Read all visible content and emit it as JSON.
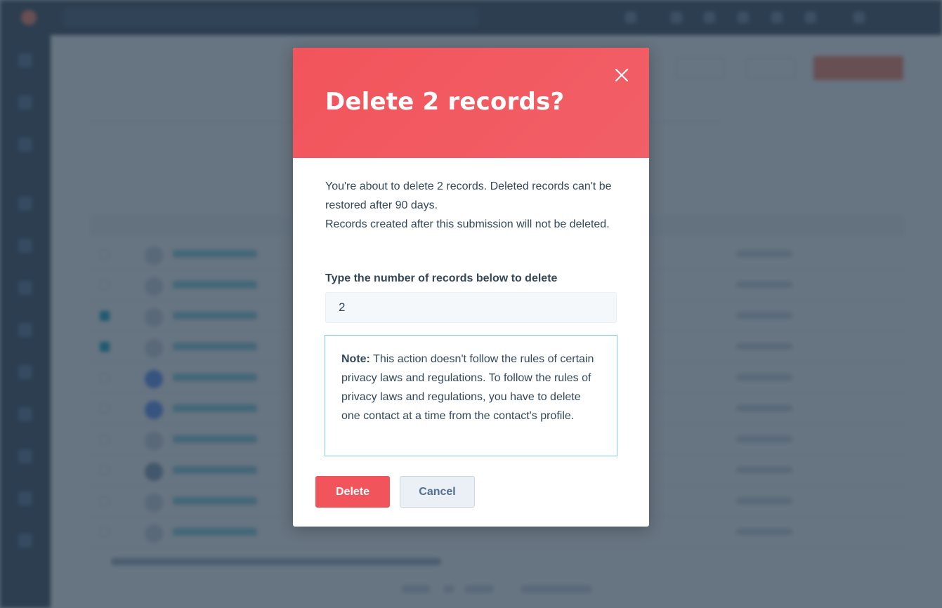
{
  "modal": {
    "title": "Delete 2 records?",
    "close_icon": "close-icon",
    "body_line1": "You're about to delete 2 records. Deleted records can't be restored after 90 days.",
    "body_line2": "Records created after this submission will not be deleted.",
    "input_label": "Type the number of records below to delete",
    "input_value": "2",
    "note_label": "Note:",
    "note_text": " This action doesn't follow the rules of certain privacy laws and regulations. To follow the rules of privacy laws and regulations, you have to delete one contact at a time from the contact's profile.",
    "delete_label": "Delete",
    "cancel_label": "Cancel"
  },
  "colors": {
    "header": "#f2545b",
    "delete_button": "#f2545b",
    "note_border": "#7fd1de",
    "overlay": "#2d3e50"
  }
}
